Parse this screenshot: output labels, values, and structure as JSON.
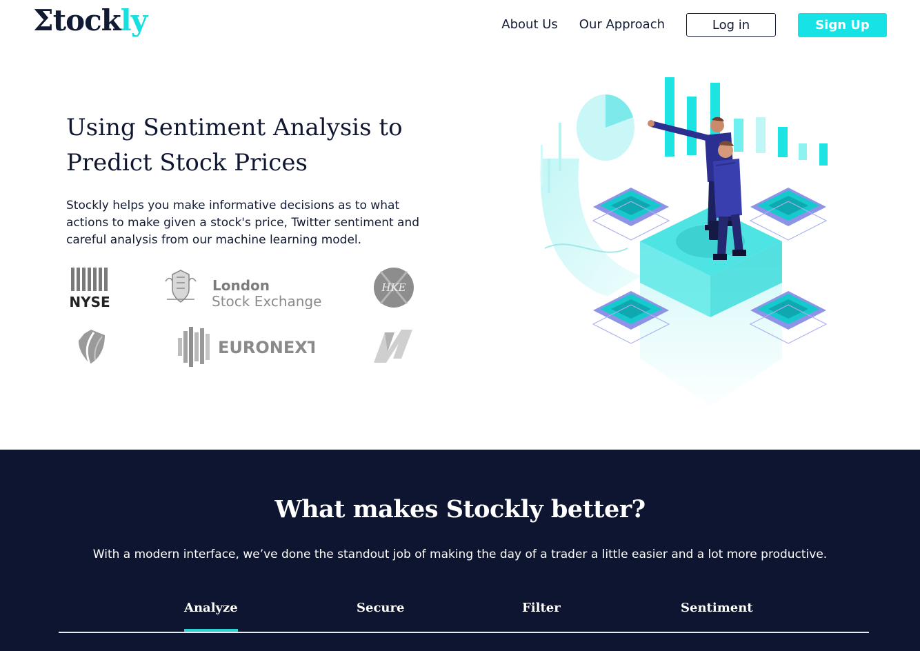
{
  "brand": {
    "logo_main": "Σtock",
    "logo_accent": "ly",
    "accent_color": "#17e3e6",
    "dark_color": "#0d1530"
  },
  "nav": {
    "links": [
      "About Us",
      "Our Approach"
    ],
    "login_label": "Log in",
    "signup_label": "Sign Up"
  },
  "hero": {
    "title": "Using Sentiment Analysis to Predict Stock Prices",
    "description": "Stockly helps you make informative decisions as to what actions to make given a stock's price, Twitter sentiment and careful analysis from our machine learning model.",
    "exchange_logos": [
      {
        "name": "NYSE",
        "text": "NYSE"
      },
      {
        "name": "London Stock Exchange",
        "text_line1": "London",
        "text_line2": "Stock Exchange"
      },
      {
        "name": "HKE",
        "text": "HKE"
      },
      {
        "name": "shield-logo"
      },
      {
        "name": "Euronext",
        "text": "EURONEXT"
      },
      {
        "name": "N-logo"
      }
    ]
  },
  "features": {
    "title": "What makes Stockly better?",
    "subtitle": "With a modern interface, we’ve done the standout job of making the day of a trader a little easier and a lot more productive.",
    "tabs": [
      "Analyze",
      "Secure",
      "Filter",
      "Sentiment"
    ],
    "active_tab": "Analyze"
  }
}
